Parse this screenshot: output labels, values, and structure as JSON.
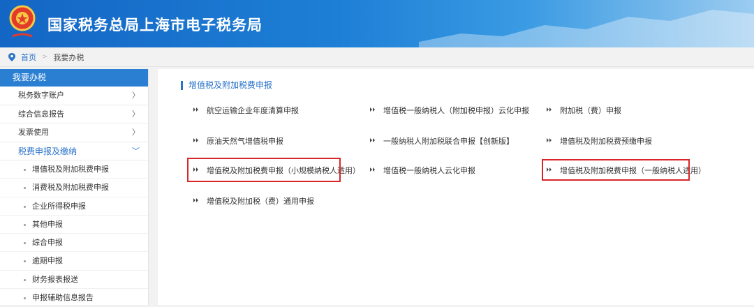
{
  "header": {
    "title": "国家税务总局上海市电子税务局"
  },
  "breadcrumb": {
    "home": "首页",
    "separator": ">",
    "current": "我要办税"
  },
  "sidebar": {
    "heading": "我要办税",
    "items": [
      {
        "label": "税务数字账户",
        "arrow": "〉"
      },
      {
        "label": "综合信息报告",
        "arrow": "〉"
      },
      {
        "label": "发票使用",
        "arrow": "〉"
      },
      {
        "label": "税费申报及缴纳",
        "arrow": "﹀"
      }
    ],
    "sub_items": [
      {
        "label": "增值税及附加税费申报"
      },
      {
        "label": "消费税及附加税费申报"
      },
      {
        "label": "企业所得税申报"
      },
      {
        "label": "其他申报"
      },
      {
        "label": "综合申报"
      },
      {
        "label": "逾期申报"
      },
      {
        "label": "财务报表报送"
      },
      {
        "label": "申报辅助信息报告"
      }
    ]
  },
  "content": {
    "section_title": "增值税及附加税费申报",
    "links": [
      {
        "label": "航空运输企业年度清算申报"
      },
      {
        "label": "增值税一般纳税人（附加税申报）云化申报"
      },
      {
        "label": "附加税（费）申报"
      },
      {
        "label": "原油天然气增值税申报"
      },
      {
        "label": "一般纳税人附加税联合申报【创新版】"
      },
      {
        "label": "增值税及附加税费预缴申报"
      },
      {
        "label": "增值税及附加税费申报（小规模纳税人适用）"
      },
      {
        "label": "增值税一般纳税人云化申报"
      },
      {
        "label": "增值税及附加税费申报（一般纳税人适用）"
      },
      {
        "label": "增值税及附加税（费）通用申报"
      }
    ]
  },
  "colors": {
    "accent": "#2b7fd3",
    "highlight": "#d9262a"
  }
}
